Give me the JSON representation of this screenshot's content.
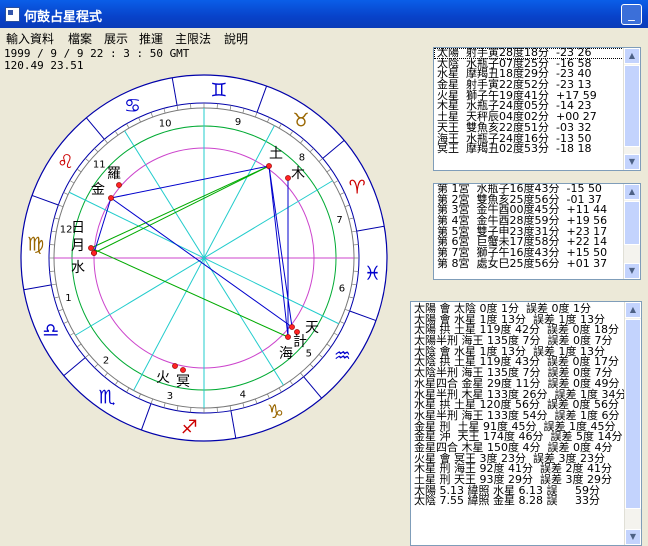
{
  "window": {
    "title": "何鼓占星程式"
  },
  "menu": [
    "輸入資料",
    "檔案",
    "展示",
    "推運",
    "主限法",
    "說明"
  ],
  "chart_info": {
    "datetime": "1999 / 9 / 9    22 : 3 : 50 GMT",
    "coords": "120.49   23.51"
  },
  "signs": [
    "♈",
    "♉",
    "♊",
    "♋",
    "♌",
    "♍",
    "♎",
    "♏",
    "♐",
    "♑",
    "♒",
    "♓"
  ],
  "house_numbers": [
    "1",
    "2",
    "3",
    "4",
    "5",
    "6",
    "7",
    "8",
    "9",
    "10",
    "11",
    "12"
  ],
  "planet_labels": {
    "sun": "日",
    "moon": "月",
    "mercury": "水",
    "venus": "金",
    "mars": "火",
    "jupiter": "木",
    "saturn": "土",
    "uranus": "天",
    "neptune": "海",
    "pluto": "冥",
    "node": "羅",
    "part": "計"
  },
  "planet_list": [
    "太陽  射手寅28度18分  -23 26",
    "太陰  水瓶子07度25分  -16 58",
    "水星  摩羯丑18度29分  -23 40",
    "金星  射手寅22度52分  -23 13",
    "火星  獅子午19度41分  +17 59",
    "木星  水瓶子24度05分  -14 23",
    "土星  天秤辰04度02分  +00 27",
    "天王  雙魚亥22度51分  -03 32",
    "海王  水瓶子24度16分  -13 50",
    "冥王  摩羯丑02度53分  -18 18"
  ],
  "house_list": [
    "第 1宮  水瓶子16度43分  -15 50",
    "第 2宮  雙魚亥25度56分  -01 37",
    "第 3宮  金牛酉00度45分  +11 44",
    "第 4宮  金牛酉28度59分  +19 56",
    "第 5宮  雙子申23度31分  +23 17",
    "第 6宮  巨蟹未17度58分  +22 14",
    "第 7宮  獅子午16度43分  +15 50",
    "第 8宮  處女巳25度56分  +01 37"
  ],
  "aspect_list": [
    "太陽 會 太陰 0度 1分  誤差 0度 1分",
    "太陽 會 水星 1度 13分  誤差 1度 13分",
    "太陽 拱 土星 119度 42分  誤差 0度 18分",
    "太陽半刑 海王 135度 7分  誤差 0度 7分",
    "太陰 會 水星 1度 13分  誤差 1度 13分",
    "太陰 拱 土星 119度 43分  誤差 0度 17分",
    "太陰半刑 海王 135度 7分  誤差 0度 7分",
    "水星四合 金星 29度 11分  誤差 0度 49分",
    "水星半刑 木星 133度 26分  誤差 1度 34分",
    "水星 拱 土星 120度 56分  誤差 0度 56分",
    "水星半刑 海王 133度 54分  誤差 1度 6分",
    "金星 刑  土星 91度 45分  誤差 1度 45分",
    "金星 沖  天王 174度 46分  誤差 5度 14分",
    "金星四合 木星 150度 4分  誤差 0度 4分",
    "火星 會 冥王 3度 23分  誤差 3度 23分",
    "木星 刑 海王 92度 41分  誤差 2度 41分",
    "土星 刑 天王 93度 29分  誤差 3度 29分",
    "太陽 5.13 緯照 水星 6.13 誤     59分",
    "太陰 7.55 緯照 金星 8.28 誤     33分"
  ]
}
